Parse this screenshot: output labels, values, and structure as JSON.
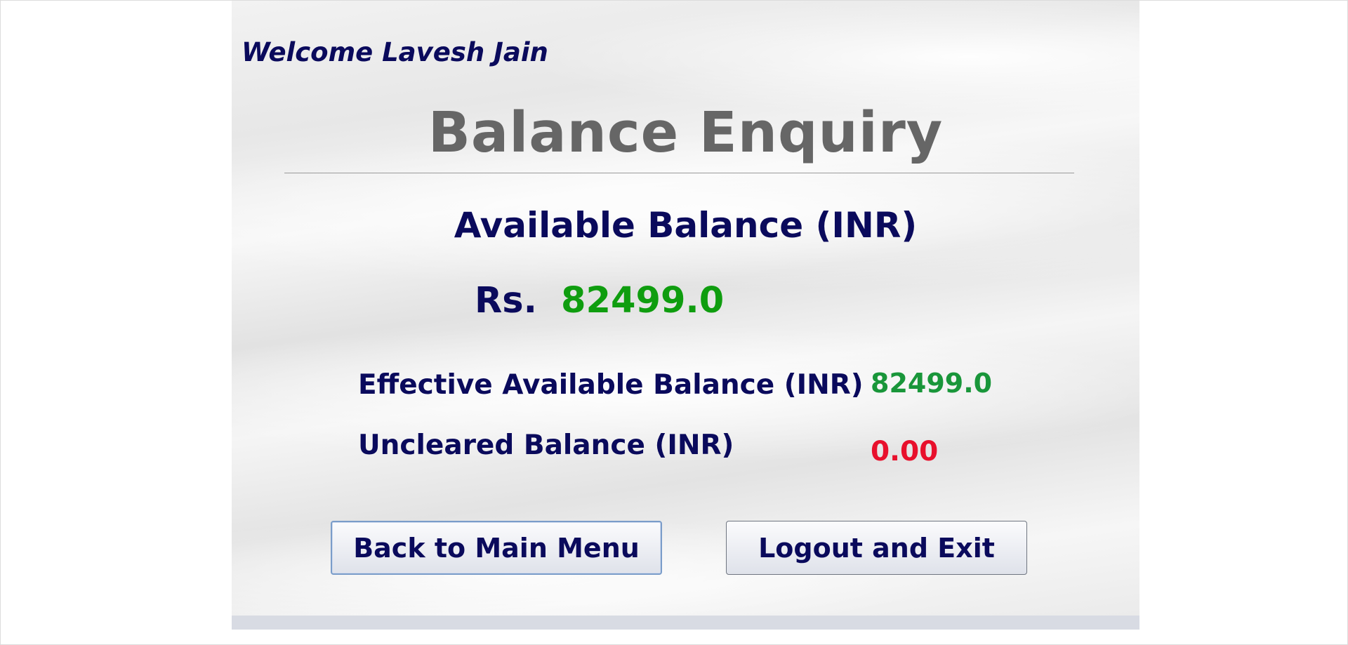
{
  "header": {
    "welcome_text": "Welcome Lavesh Jain"
  },
  "page": {
    "title": "Balance Enquiry"
  },
  "available_balance": {
    "heading": "Available Balance (INR)",
    "currency_prefix": "Rs.",
    "amount": "82499.0"
  },
  "details": {
    "effective_label": "Effective Available Balance (INR)",
    "effective_value": "82499.0",
    "uncleared_label": "Uncleared Balance (INR)",
    "uncleared_value": "0.00"
  },
  "actions": {
    "back_label": "Back to Main Menu",
    "logout_label": "Logout and Exit"
  },
  "colors": {
    "heading_navy": "#0a0a5c",
    "title_gray": "#666666",
    "amount_green": "#0f9d0f",
    "uncleared_red": "#e8102c"
  }
}
